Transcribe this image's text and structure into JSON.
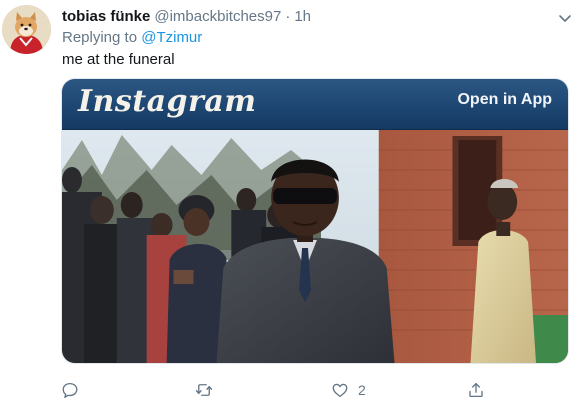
{
  "tweet": {
    "author": {
      "display_name": "tobias fünke",
      "handle": "@imbackbitches97",
      "separator": "·",
      "time": "1h"
    },
    "replying_to": {
      "prefix": "Replying to",
      "mention": "@Tzimur"
    },
    "text": "me at the funeral",
    "media": {
      "logo_text": "Instagram",
      "open_app_label": "Open in App"
    },
    "actions": {
      "reply_count": "",
      "retweet_count": "",
      "like_count": "2",
      "share_count": ""
    }
  },
  "icons": {
    "reply": "comment-bubble-icon",
    "retweet": "retweet-arrows-icon",
    "like": "heart-icon",
    "share": "share-upload-icon",
    "more": "chevron-down-icon"
  },
  "colors": {
    "text_primary": "#14171a",
    "text_secondary": "#657786",
    "link": "#1b95e0",
    "icon": "#657786",
    "instagram_bar": "#1d4672"
  }
}
